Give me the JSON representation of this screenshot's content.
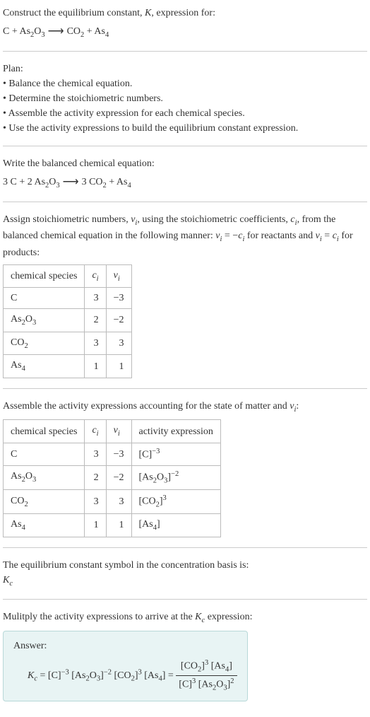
{
  "header": {
    "line1": "Construct the equilibrium constant, ",
    "k": "K",
    "line1b": ", expression for:",
    "eq_lhs": "C + As",
    "eq_lhs_sub1": "2",
    "eq_lhs2": "O",
    "eq_lhs_sub2": "3",
    "arrow": " ⟶ ",
    "eq_rhs": "CO",
    "eq_rhs_sub1": "2",
    "eq_rhs2": " + As",
    "eq_rhs_sub2": "4"
  },
  "plan": {
    "title": "Plan:",
    "b1": "• Balance the chemical equation.",
    "b2": "• Determine the stoichiometric numbers.",
    "b3": "• Assemble the activity expression for each chemical species.",
    "b4": "• Use the activity expressions to build the equilibrium constant expression."
  },
  "balanced": {
    "title": "Write the balanced chemical equation:",
    "c1": "3 C + 2 As",
    "s1": "2",
    "c2": "O",
    "s2": "3",
    "arrow": " ⟶ ",
    "c3": "3 CO",
    "s3": "2",
    "c4": " + As",
    "s4": "4"
  },
  "assign": {
    "p1": "Assign stoichiometric numbers, ",
    "nu": "ν",
    "sub_i": "i",
    "p2": ", using the stoichiometric coefficients, ",
    "c": "c",
    "p3": ", from the balanced chemical equation in the following manner: ",
    "eq1a": "ν",
    "eq1b": " = −",
    "eq1c": "c",
    "p4": " for reactants and ",
    "eq2a": "ν",
    "eq2b": " = ",
    "eq2c": "c",
    "p5": " for products:"
  },
  "table1": {
    "h1": "chemical species",
    "h2": "c",
    "h2sub": "i",
    "h3": "ν",
    "h3sub": "i",
    "rows": [
      {
        "sp": "C",
        "sp_sub": "",
        "c": "3",
        "nu": "−3"
      },
      {
        "sp": "As",
        "sp_sub": "2",
        "sp2": "O",
        "sp_sub2": "3",
        "c": "2",
        "nu": "−2"
      },
      {
        "sp": "CO",
        "sp_sub": "2",
        "c": "3",
        "nu": "3"
      },
      {
        "sp": "As",
        "sp_sub": "4",
        "c": "1",
        "nu": "1"
      }
    ]
  },
  "assemble": {
    "p1": "Assemble the activity expressions accounting for the state of matter and ",
    "nu": "ν",
    "sub_i": "i",
    "p2": ":"
  },
  "table2": {
    "h1": "chemical species",
    "h2": "c",
    "h2sub": "i",
    "h3": "ν",
    "h3sub": "i",
    "h4": "activity expression",
    "rows": [
      {
        "sp": "C",
        "c": "3",
        "nu": "−3",
        "act": "[C]",
        "act_sup": "−3"
      },
      {
        "sp": "As",
        "sp_sub": "2",
        "sp2": "O",
        "sp_sub2": "3",
        "c": "2",
        "nu": "−2",
        "act": "[As",
        "act_sub": "2",
        "act2": "O",
        "act_sub2": "3",
        "act3": "]",
        "act_sup": "−2"
      },
      {
        "sp": "CO",
        "sp_sub": "2",
        "c": "3",
        "nu": "3",
        "act": "[CO",
        "act_sub": "2",
        "act3": "]",
        "act_sup": "3"
      },
      {
        "sp": "As",
        "sp_sub": "4",
        "c": "1",
        "nu": "1",
        "act": "[As",
        "act_sub": "4",
        "act3": "]"
      }
    ]
  },
  "symbol": {
    "p1": "The equilibrium constant symbol in the concentration basis is:",
    "kc": "K",
    "kcsub": "c"
  },
  "multiply": {
    "p1": "Mulitply the activity expressions to arrive at the ",
    "kc": "K",
    "kcsub": "c",
    "p2": " expression:"
  },
  "answer": {
    "label": "Answer:",
    "kc": "K",
    "kcsub": "c",
    "eq": " = [C]",
    "sup1": "−3",
    "t2": " [As",
    "sub2a": "2",
    "t2b": "O",
    "sub2b": "3",
    "t2c": "]",
    "sup2": "−2",
    "t3": " [CO",
    "sub3": "2",
    "t3b": "]",
    "sup3": "3",
    "t4": " [As",
    "sub4": "4",
    "t4b": "] = ",
    "frac_top1": "[CO",
    "frac_top1sub": "2",
    "frac_top1b": "]",
    "frac_top1sup": "3",
    "frac_top2": " [As",
    "frac_top2sub": "4",
    "frac_top2b": "]",
    "frac_bot1": "[C]",
    "frac_bot1sup": "3",
    "frac_bot2": " [As",
    "frac_bot2sub": "2",
    "frac_bot2b": "O",
    "frac_bot2sub2": "3",
    "frac_bot2c": "]",
    "frac_bot2sup": "2"
  }
}
